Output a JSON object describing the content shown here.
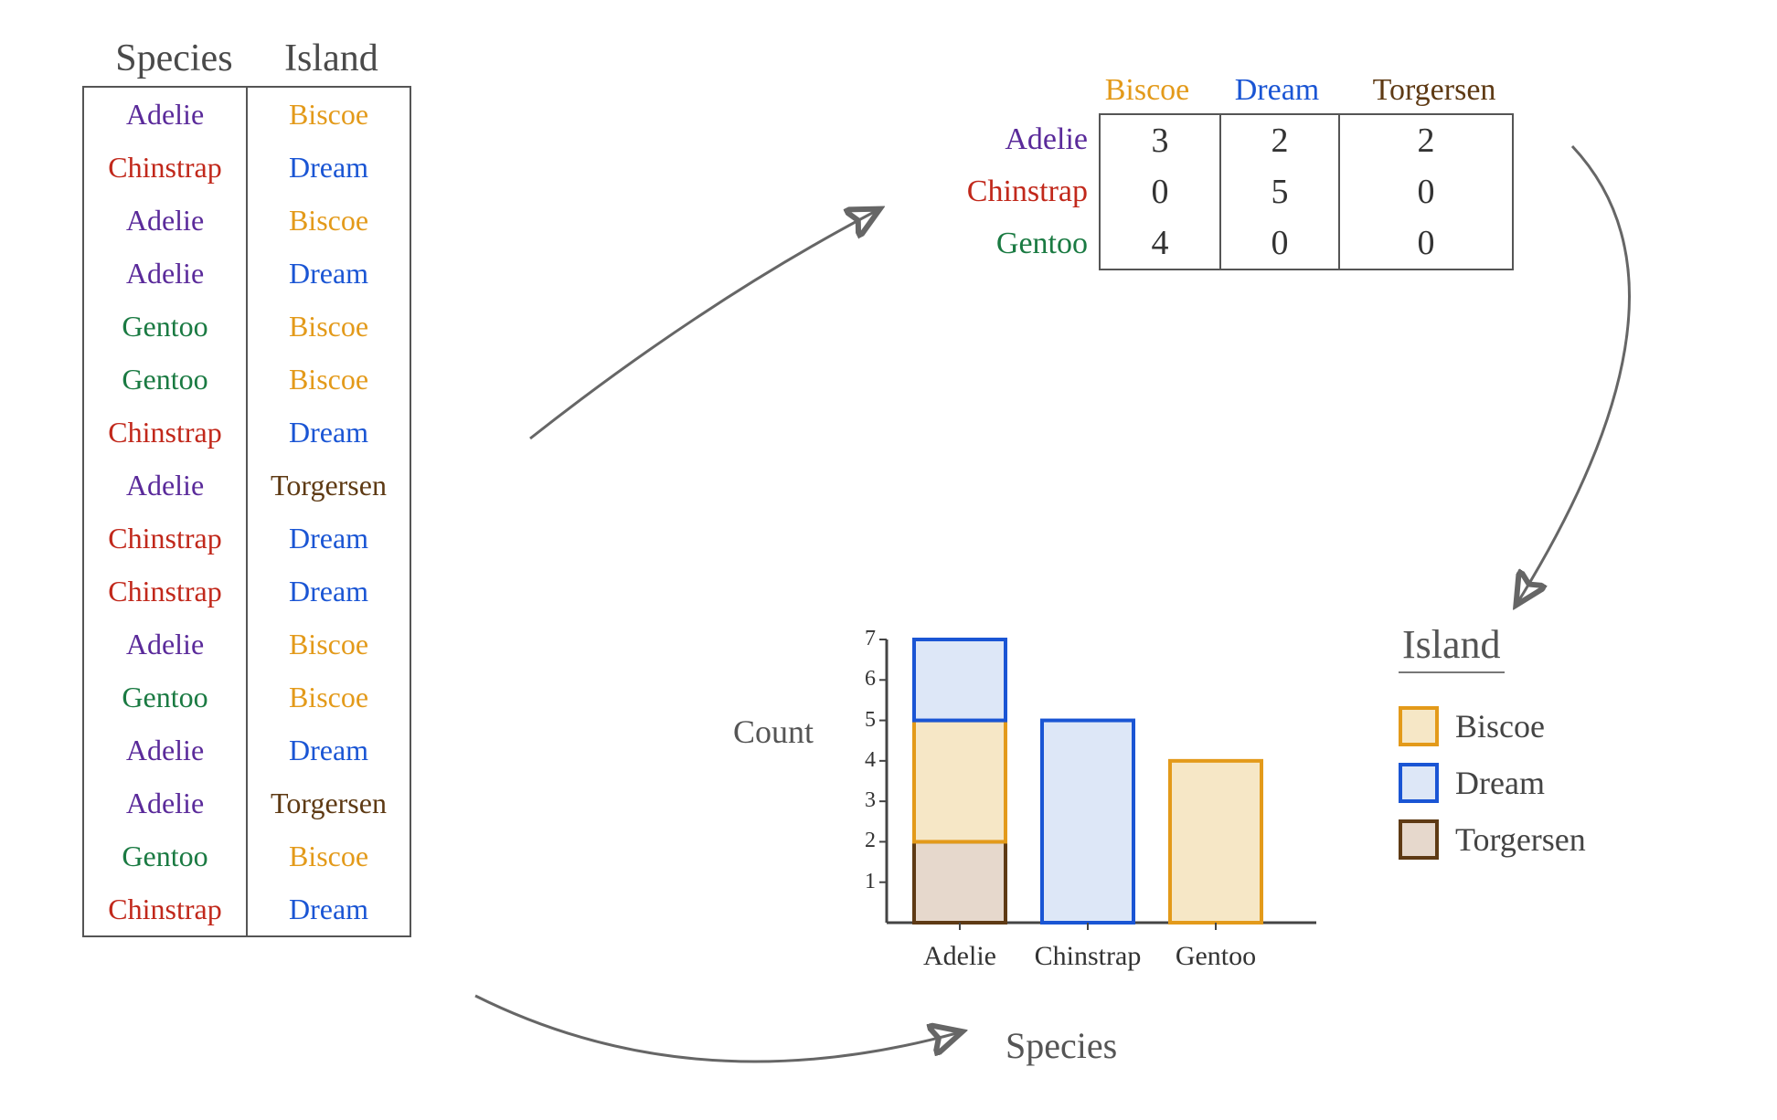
{
  "raw_table": {
    "headers": [
      "Species",
      "Island"
    ],
    "rows": [
      {
        "species": "Adelie",
        "island": "Biscoe"
      },
      {
        "species": "Chinstrap",
        "island": "Dream"
      },
      {
        "species": "Adelie",
        "island": "Biscoe"
      },
      {
        "species": "Adelie",
        "island": "Dream"
      },
      {
        "species": "Gentoo",
        "island": "Biscoe"
      },
      {
        "species": "Gentoo",
        "island": "Biscoe"
      },
      {
        "species": "Chinstrap",
        "island": "Dream"
      },
      {
        "species": "Adelie",
        "island": "Torgersen"
      },
      {
        "species": "Chinstrap",
        "island": "Dream"
      },
      {
        "species": "Chinstrap",
        "island": "Dream"
      },
      {
        "species": "Adelie",
        "island": "Biscoe"
      },
      {
        "species": "Gentoo",
        "island": "Biscoe"
      },
      {
        "species": "Adelie",
        "island": "Dream"
      },
      {
        "species": "Adelie",
        "island": "Torgersen"
      },
      {
        "species": "Gentoo",
        "island": "Biscoe"
      },
      {
        "species": "Chinstrap",
        "island": "Dream"
      }
    ]
  },
  "crosstab": {
    "row_labels": [
      "Adelie",
      "Chinstrap",
      "Gentoo"
    ],
    "col_labels": [
      "Biscoe",
      "Dream",
      "Torgersen"
    ],
    "values": [
      [
        3,
        2,
        2
      ],
      [
        0,
        5,
        0
      ],
      [
        4,
        0,
        0
      ]
    ]
  },
  "legend": {
    "title": "Island",
    "items": [
      "Biscoe",
      "Dream",
      "Torgersen"
    ]
  },
  "chart_data": {
    "type": "bar",
    "stacked": true,
    "title": "",
    "xlabel": "Species",
    "ylabel": "Count",
    "ylim": [
      0,
      7
    ],
    "yticks": [
      1,
      2,
      3,
      4,
      5,
      6,
      7
    ],
    "categories": [
      "Adelie",
      "Chinstrap",
      "Gentoo"
    ],
    "series": [
      {
        "name": "Torgersen",
        "values": [
          2,
          0,
          0
        ],
        "stroke": "#5e3a14",
        "fill": "#e6d8cc"
      },
      {
        "name": "Biscoe",
        "values": [
          3,
          0,
          4
        ],
        "stroke": "#e39a1a",
        "fill": "#f6e7c6"
      },
      {
        "name": "Dream",
        "values": [
          2,
          5,
          0
        ],
        "stroke": "#1a55d4",
        "fill": "#dde7f7"
      }
    ],
    "legend_order": [
      "Biscoe",
      "Dream",
      "Torgersen"
    ]
  },
  "colors": {
    "Adelie": "#5a2a9a",
    "Chinstrap": "#c1281b",
    "Gentoo": "#1a7a42",
    "Biscoe": "#e39a1a",
    "Dream": "#1a55d4",
    "Torgersen": "#5e3a14"
  }
}
